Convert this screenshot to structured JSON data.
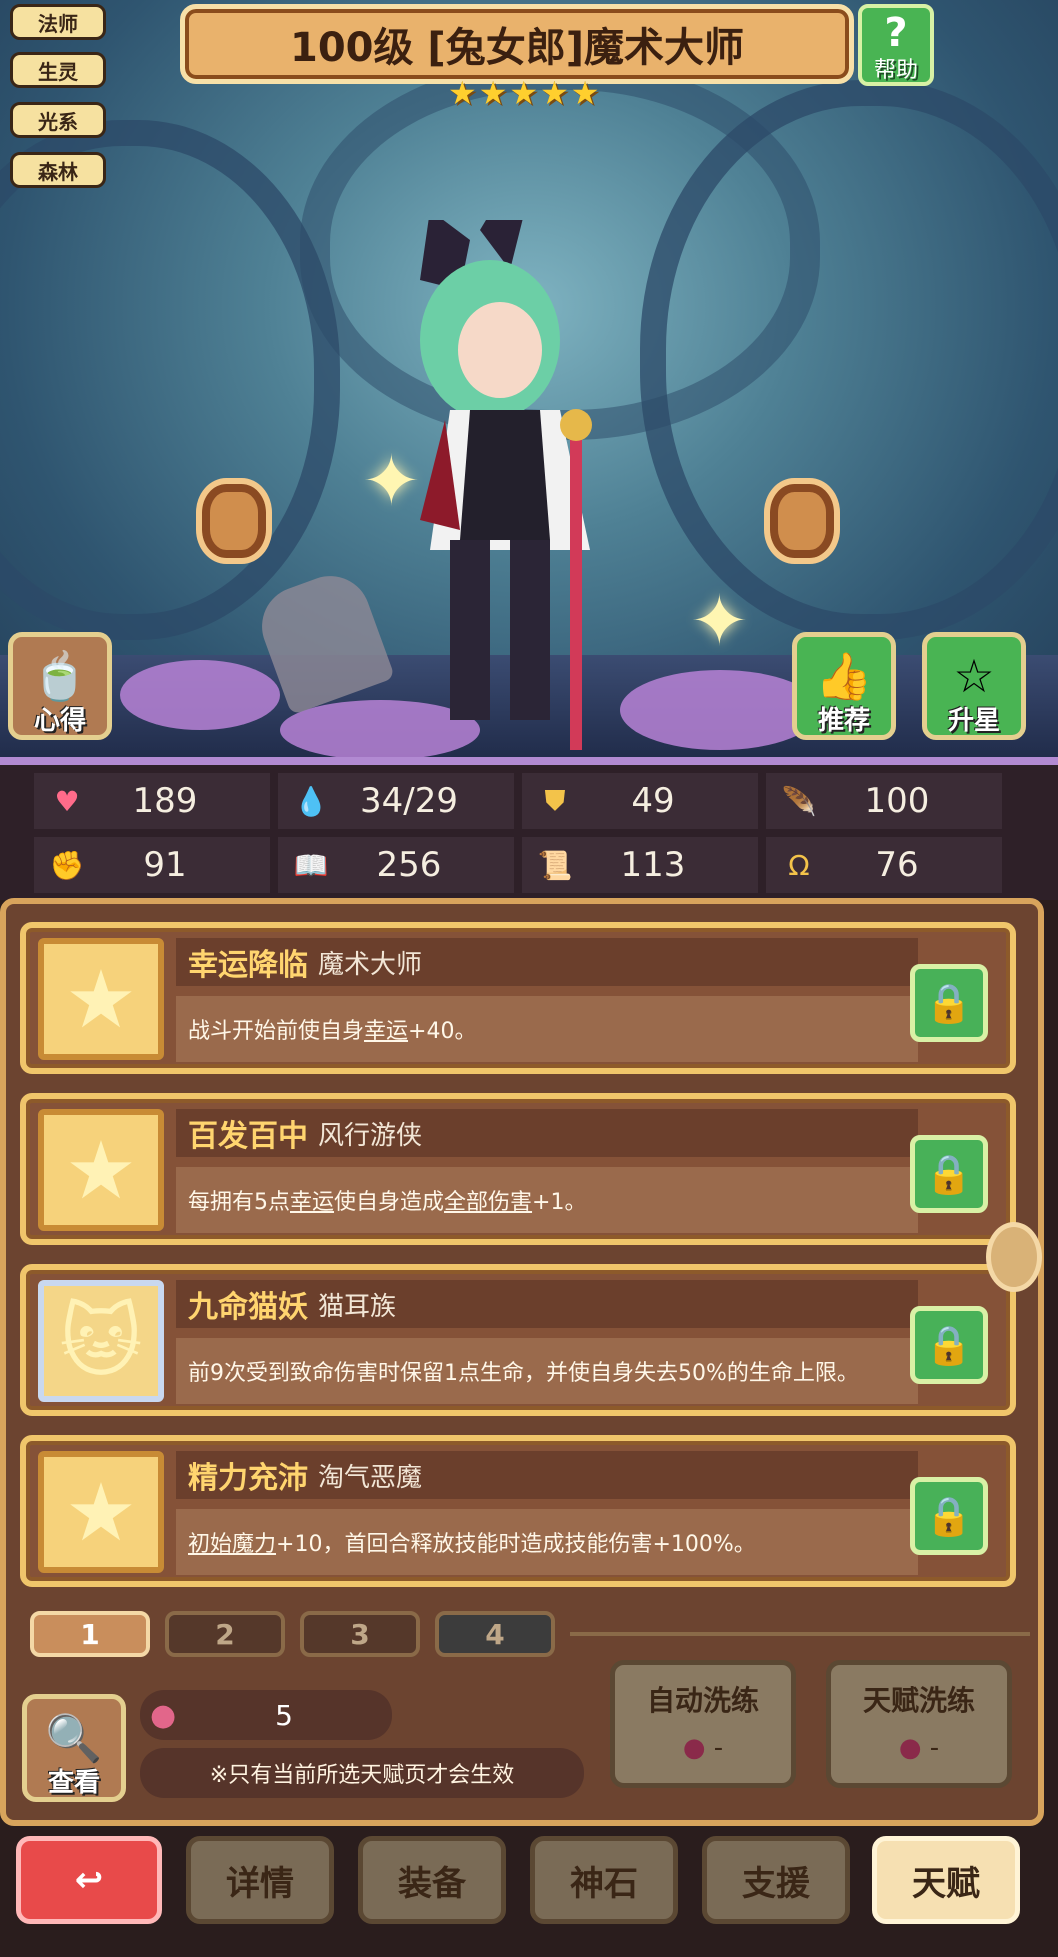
{
  "tags": [
    "法师",
    "生灵",
    "光系",
    "森林"
  ],
  "title": "100级 [兔女郎]魔术大师",
  "stars": 5,
  "help_label": "帮助",
  "side_buttons": {
    "insight": "心得",
    "recommend": "推荐",
    "upgrade_star": "升星"
  },
  "stats": [
    {
      "icon": "heart-icon",
      "value": "189"
    },
    {
      "icon": "mana-drop-icon",
      "value": "34/29"
    },
    {
      "icon": "shield-icon",
      "value": "49"
    },
    {
      "icon": "wing-icon",
      "value": "100"
    },
    {
      "icon": "fist-icon",
      "value": "91"
    },
    {
      "icon": "book-icon",
      "value": "256"
    },
    {
      "icon": "scroll-icon",
      "value": "113"
    },
    {
      "icon": "horseshoe-icon",
      "value": "76"
    }
  ],
  "talents": [
    {
      "name": "幸运降临",
      "race": "魔术大师",
      "desc_parts": [
        "战斗开始前使自身",
        "幸运",
        "+40。"
      ]
    },
    {
      "name": "百发百中",
      "race": "风行游侠",
      "desc_parts": [
        "每拥有5点",
        "幸运",
        "使自身造成",
        "全部伤害",
        "+1。"
      ]
    },
    {
      "name": "九命猫妖",
      "race": "猫耳族",
      "desc_parts": [
        "前9次受到致命伤害时保留1点生命，并使自身失去50%的生命上限。"
      ]
    },
    {
      "name": "精力充沛",
      "race": "淘气恶魔",
      "desc_parts": [
        "初始魔力",
        "+10，首回合释放技能时造成技能伤害+100%。"
      ]
    }
  ],
  "pages": [
    "1",
    "2",
    "3",
    "4"
  ],
  "view_label": "查看",
  "fruit_count": "5",
  "note": "※只有当前所选天赋页才会生效",
  "auto_wash": {
    "label": "自动洗练",
    "cost": "-"
  },
  "talent_wash": {
    "label": "天赋洗练",
    "cost": "-"
  },
  "nav": [
    "详情",
    "装备",
    "神石",
    "支援",
    "天赋"
  ],
  "colors": {
    "accent_green": "#48b158",
    "nav_active": "#f6e0b2",
    "back_red": "#e84a4a",
    "gold": "#ffd56f"
  }
}
